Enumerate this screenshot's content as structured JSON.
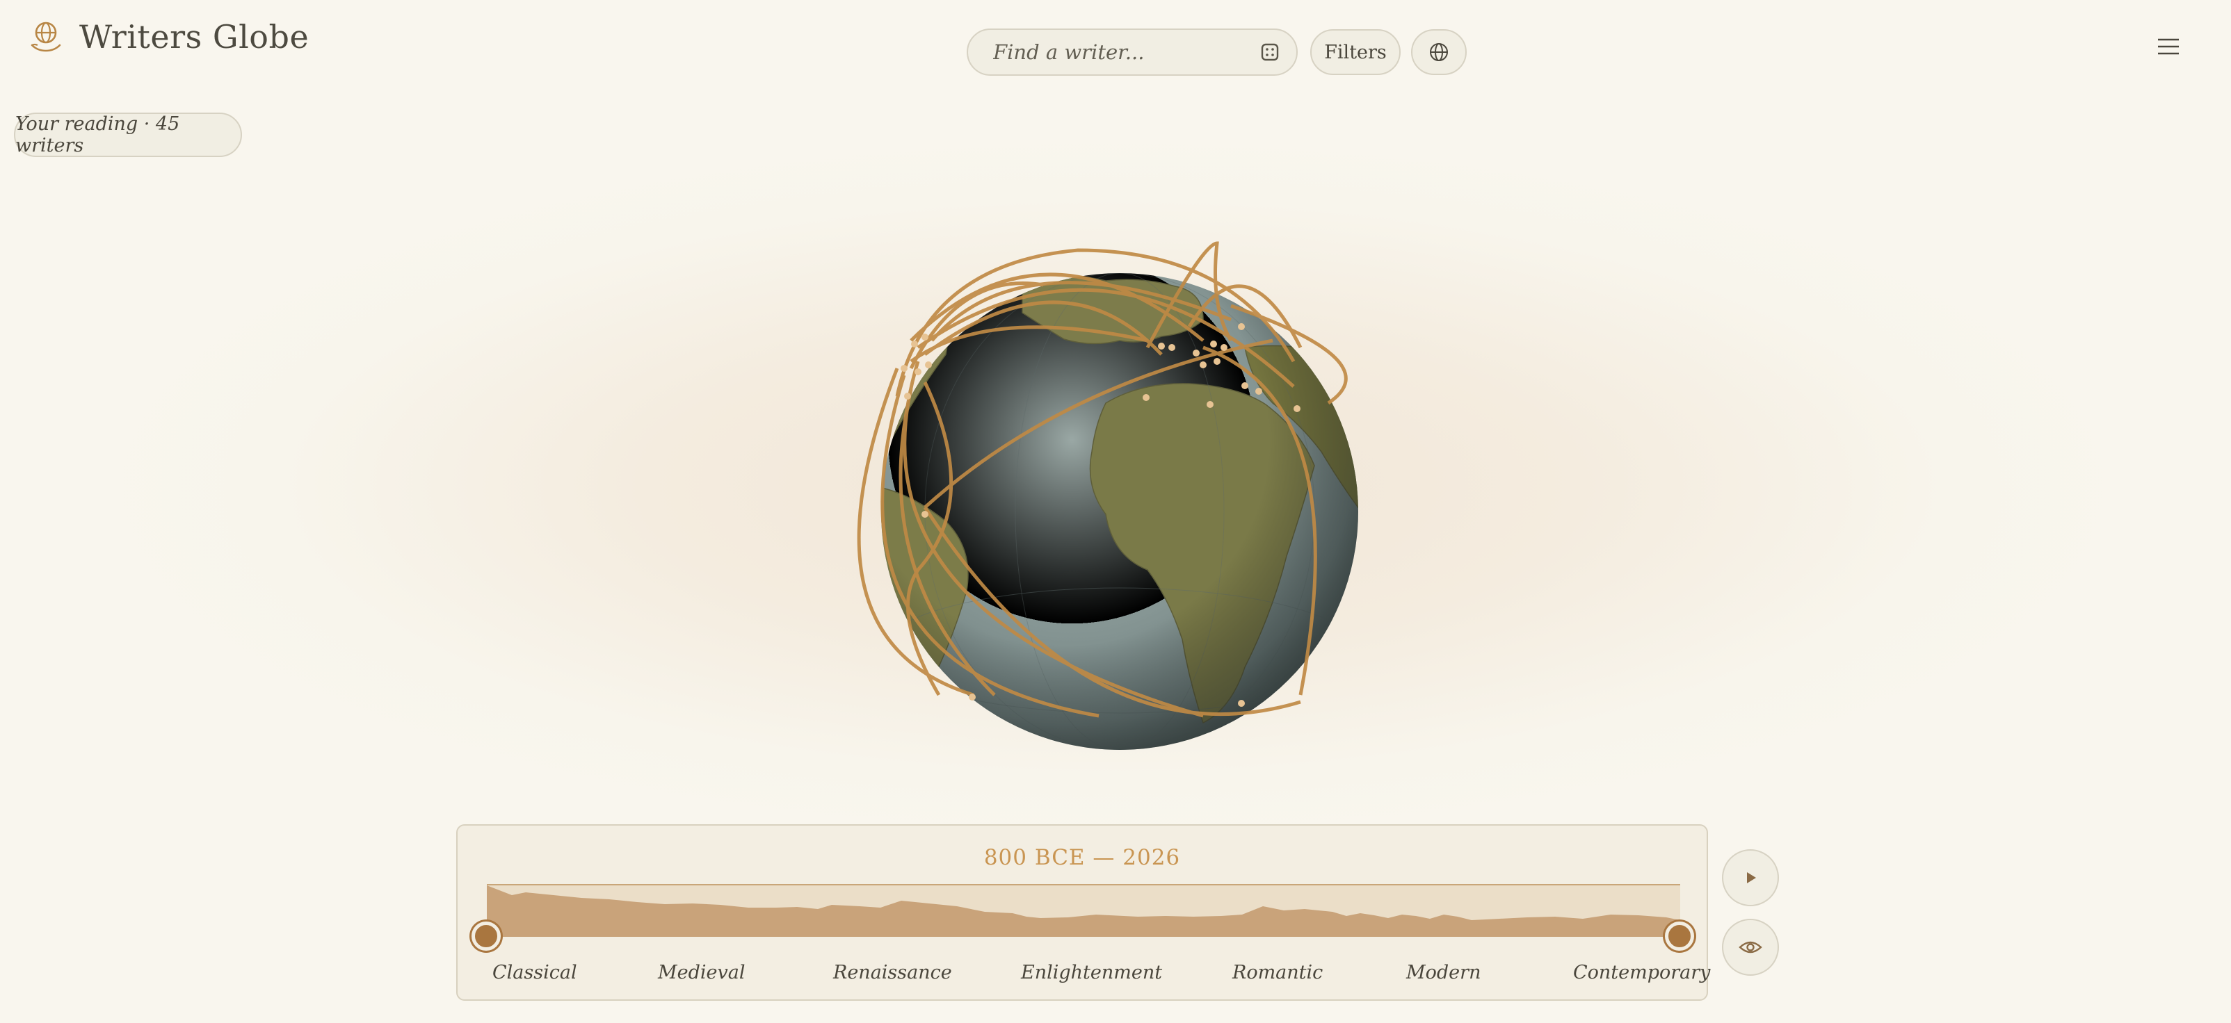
{
  "app": {
    "title": "Writers Globe"
  },
  "search": {
    "placeholder": "Find a writer..."
  },
  "toolbar": {
    "filters_label": "Filters"
  },
  "reading": {
    "label": "Your reading · 45 writers"
  },
  "timeline": {
    "range_label": "800 BCE — 2026",
    "start_label": "800 BCE",
    "end_label": "2026",
    "eras": [
      "Classical",
      "Medieval",
      "Renaissance",
      "Enlightenment",
      "Romantic",
      "Modern",
      "Contemporary"
    ]
  },
  "icons": {
    "logo": "globe-hand-icon",
    "search_action": "dice-icon",
    "globe_toggle": "globe-icon",
    "menu": "hamburger-menu-icon",
    "play": "play-icon",
    "view": "eye-icon"
  },
  "colors": {
    "accent": "#c08a45",
    "handle": "#a9763f",
    "ocean": "#8a9a98",
    "land": "#7c7c4a",
    "background": "#f9f6ee"
  }
}
